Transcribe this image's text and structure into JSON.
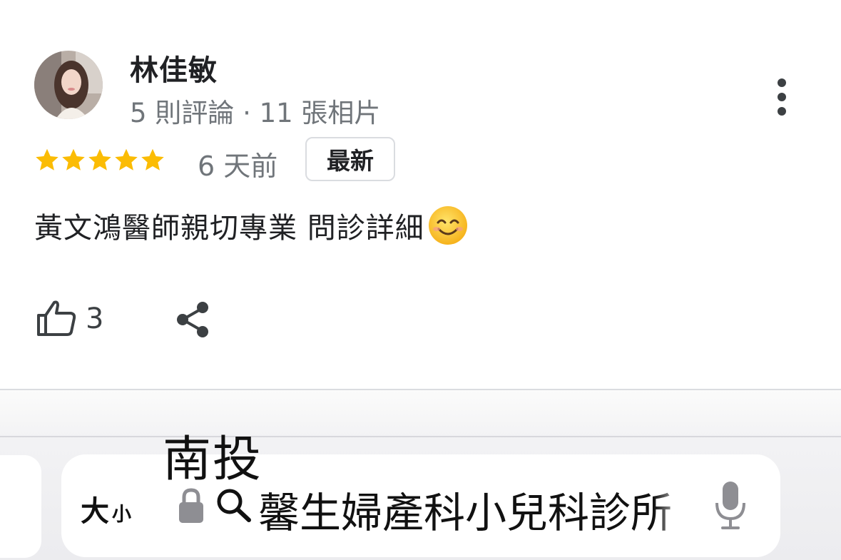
{
  "review": {
    "reviewer_name": "林佳敏",
    "reviewer_meta": "5 則評論 · 11 張相片",
    "rating": 5,
    "rating_max": 5,
    "date": "6 天前",
    "badge": "最新",
    "text": "黃文鴻醫師親切專業 問診詳細",
    "emoji": "smiling-face-icon",
    "like_count": "3"
  },
  "overlay": {
    "caption": "南投"
  },
  "browser": {
    "text_size_large": "大",
    "text_size_small": "小",
    "url_text": "馨生婦產科小兒科診所"
  },
  "colors": {
    "star": "#fbbc04",
    "secondary_text": "#70757a",
    "badge_border": "#dadce0"
  }
}
